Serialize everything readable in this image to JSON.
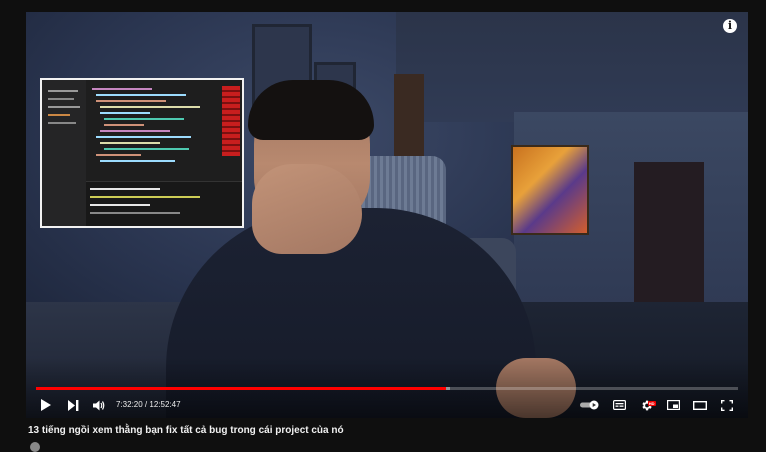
{
  "video": {
    "title": "13 tiếng ngồi xem thằng bạn fix tất cả bug trong cái project của nó",
    "current_time": "7:32:20",
    "duration": "12:52:47",
    "time_separator": " / ",
    "progress_fraction": 0.5847,
    "buffered_fraction": 0.59,
    "info_label": "i"
  },
  "controls": {
    "play_icon": "play-icon",
    "next_icon": "next-icon",
    "volume_icon": "volume-icon",
    "autoplay_icon": "autoplay-toggle-icon",
    "subtitles_icon": "subtitles-icon",
    "settings_icon": "gear-icon",
    "settings_badge": "HD",
    "miniplayer_icon": "miniplayer-icon",
    "theater_icon": "theater-mode-icon",
    "fullscreen_icon": "fullscreen-icon"
  },
  "colors": {
    "progress": "#ff0000",
    "background": "#0f0f0f",
    "badge": "#e00000"
  }
}
